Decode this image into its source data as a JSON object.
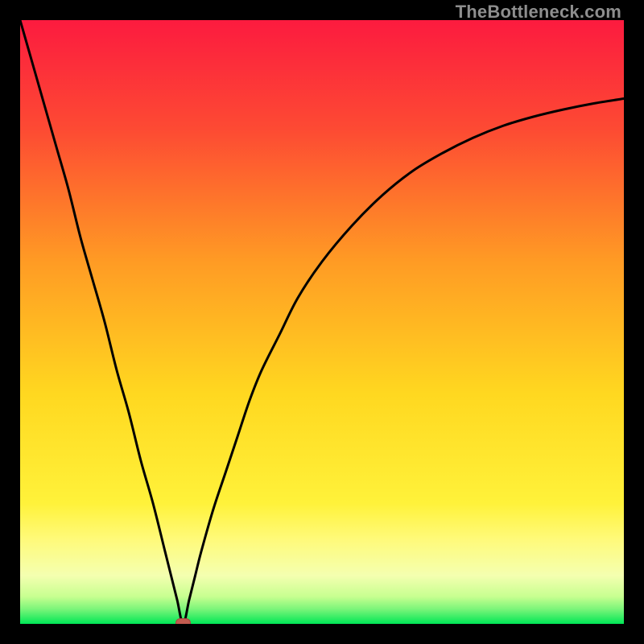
{
  "watermark": "TheBottleneck.com",
  "colors": {
    "frame": "#000000",
    "gradient_top": "#fc1b3f",
    "gradient_mid_upper": "#fd7e2a",
    "gradient_mid": "#ffd820",
    "gradient_mid_lower": "#fffa7a",
    "gradient_lower": "#e7ff85",
    "gradient_bottom": "#00e756",
    "curve": "#000000",
    "marker_fill": "#c25b4f",
    "marker_stroke": "#a84a40"
  },
  "chart_data": {
    "type": "line",
    "title": "",
    "xlabel": "",
    "ylabel": "",
    "xlim": [
      0,
      100
    ],
    "ylim": [
      0,
      100
    ],
    "grid": false,
    "legend": false,
    "notch_x": 27,
    "series": [
      {
        "name": "curve",
        "x": [
          0,
          2,
          4,
          6,
          8,
          10,
          12,
          14,
          16,
          18,
          20,
          22,
          24,
          25,
          26,
          27,
          28,
          29,
          30,
          32,
          34,
          36,
          38,
          40,
          43,
          46,
          50,
          55,
          60,
          65,
          70,
          75,
          80,
          85,
          90,
          95,
          100
        ],
        "y": [
          100,
          93,
          86,
          79,
          72,
          64,
          57,
          50,
          42,
          35,
          27,
          20,
          12,
          8,
          4,
          0,
          4,
          8,
          12,
          19,
          25,
          31,
          37,
          42,
          48,
          54,
          60,
          66,
          71,
          75,
          78,
          80.5,
          82.5,
          84,
          85.2,
          86.2,
          87
        ]
      }
    ],
    "marker": {
      "x": 27,
      "y": 0,
      "shape": "rounded-rect",
      "w": 2.6,
      "h": 1.5
    }
  }
}
